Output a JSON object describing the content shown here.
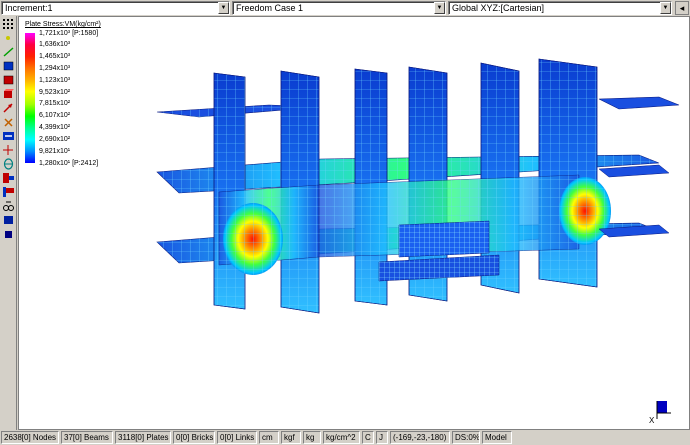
{
  "topbar": {
    "increment": "Increment:1",
    "load_case": "Freedom Case 1",
    "coord_system": "Global XYZ:[Cartesian]"
  },
  "legend": {
    "title": "Plate Stress:VM(kg/cm²)",
    "entries": [
      {
        "label": "1,721x10³ [P:1580]",
        "color": "#ff00ff"
      },
      {
        "label": "1,636x10³",
        "color": "#ff0040"
      },
      {
        "label": "1,465x10³",
        "color": "#ff2000"
      },
      {
        "label": "1,294x10³",
        "color": "#ff7000"
      },
      {
        "label": "1,123x10³",
        "color": "#ffb000"
      },
      {
        "label": "9,523x10²",
        "color": "#ffff00"
      },
      {
        "label": "7,815x10²",
        "color": "#a0ff00"
      },
      {
        "label": "6,107x10²",
        "color": "#00ff00"
      },
      {
        "label": "4,399x10²",
        "color": "#00ff90"
      },
      {
        "label": "2,690x10²",
        "color": "#00ffff"
      },
      {
        "label": "9,821x10¹",
        "color": "#0090ff"
      },
      {
        "label": "1,280x10¹ [P:2412]",
        "color": "#0000ff"
      }
    ]
  },
  "triad": {
    "axis_label": "X"
  },
  "statusbar": {
    "nodes": "2638[0] Nodes",
    "beams": "37[0] Beams",
    "plates": "3118[0] Plates",
    "bricks": "0[0] Bricks",
    "links": "0[0] Links",
    "length_unit": "cm",
    "force_unit": "kgf",
    "mass_unit": "kg",
    "stress_unit": "kg/cm^2",
    "temp_unit": "C",
    "energy_unit": "J",
    "cursor": "(-169,-23,-180)",
    "ds": "DS:0%",
    "mode": "Model"
  },
  "colors": {
    "plate_blue": "#0a3fd8",
    "plate_mid": "#2aa0ff",
    "hot": "#ff2000",
    "mesh": "#5fd0ff"
  },
  "icons": [
    "grid-icon",
    "pencil-icon",
    "line-icon",
    "square-icon",
    "plate-icon",
    "brick-icon",
    "arrow-icon",
    "cross-icon",
    "node-icon",
    "beam-icon",
    "link-icon",
    "select-icon",
    "pan-icon",
    "fill-icon"
  ]
}
